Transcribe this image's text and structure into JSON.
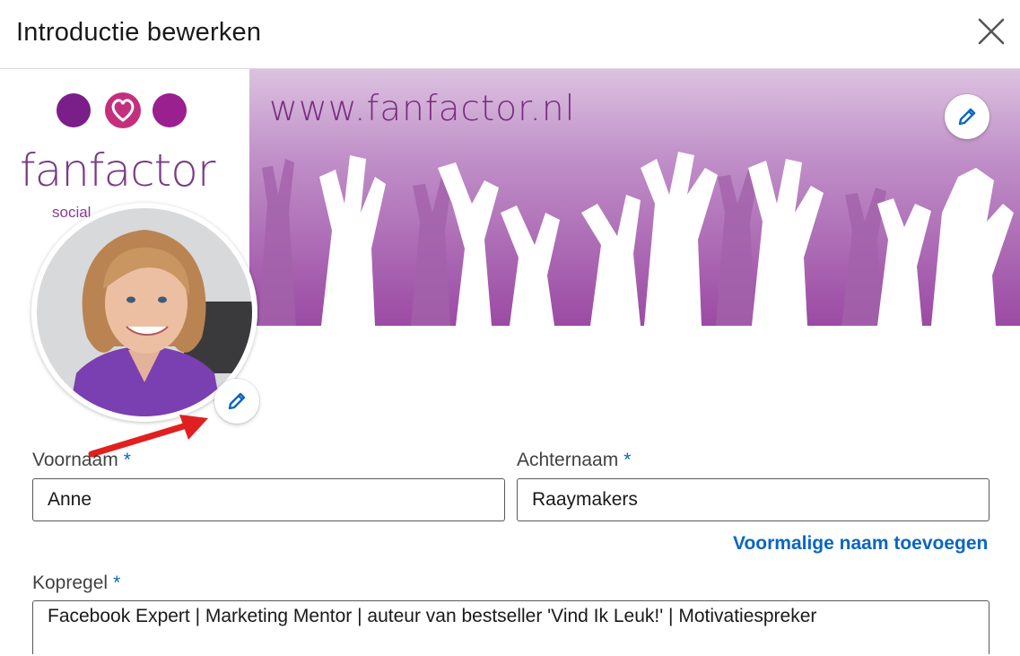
{
  "dialog": {
    "title": "Introductie bewerken",
    "close_icon": "close-icon"
  },
  "banner": {
    "logo_text": "fanfactor",
    "logo_subtext": "social",
    "url_text": "www.fanfactor.nl",
    "edit_icon": "pencil-icon",
    "colors": {
      "purple": "#9b4aa3",
      "dot_purple": "#7a1f8a",
      "heart_pink": "#c42f7d"
    }
  },
  "profile_photo": {
    "edit_icon": "pencil-icon"
  },
  "form": {
    "first_name": {
      "label": "Voornaam",
      "required_mark": "*",
      "value": "Anne"
    },
    "last_name": {
      "label": "Achternaam",
      "required_mark": "*",
      "value": "Raaymakers"
    },
    "former_name_link": "Voormalige naam toevoegen",
    "headline": {
      "label": "Kopregel",
      "required_mark": "*",
      "value": "Facebook Expert | Marketing Mentor | auteur van bestseller 'Vind Ik Leuk!' | Motivatiespreker"
    }
  },
  "accent_color": "#0a66c2",
  "annotation_arrow_color": "#e02020"
}
